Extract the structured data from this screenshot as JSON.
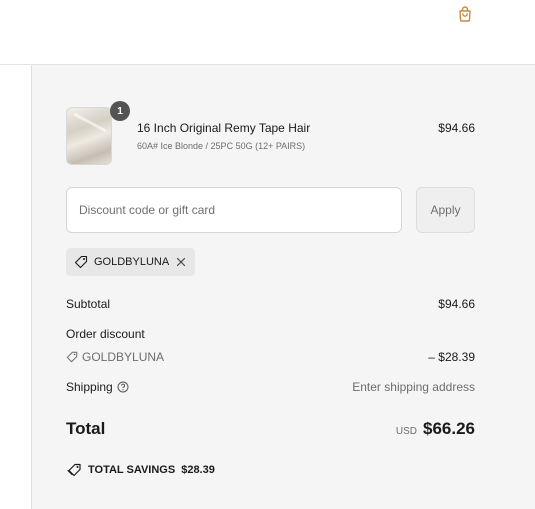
{
  "header": {
    "cart_icon": "shopping-bag-icon"
  },
  "line_item": {
    "quantity": "1",
    "title": "16 Inch Original Remy Tape Hair",
    "variant": "60A# Ice Blonde / 25PC 50G (12+ PAIRS)",
    "price": "$94.66"
  },
  "discount": {
    "placeholder": "Discount code or gift card",
    "value": "",
    "apply_label": "Apply",
    "applied_code": "GOLDBYLUNA"
  },
  "summary": {
    "subtotal_label": "Subtotal",
    "subtotal_value": "$94.66",
    "order_discount_label": "Order discount",
    "order_discount_code": "GOLDBYLUNA",
    "order_discount_value": "– $28.39",
    "shipping_label": "Shipping",
    "shipping_value": "Enter shipping address",
    "total_label": "Total",
    "total_currency": "USD",
    "total_value": "$66.26",
    "savings_label": "TOTAL SAVINGS",
    "savings_value": "$28.39"
  },
  "colors": {
    "panel_bg": "#f5f5f5",
    "badge": "#545454",
    "chip_bg": "#e7e7e7",
    "header_icon": "#c98a40"
  }
}
